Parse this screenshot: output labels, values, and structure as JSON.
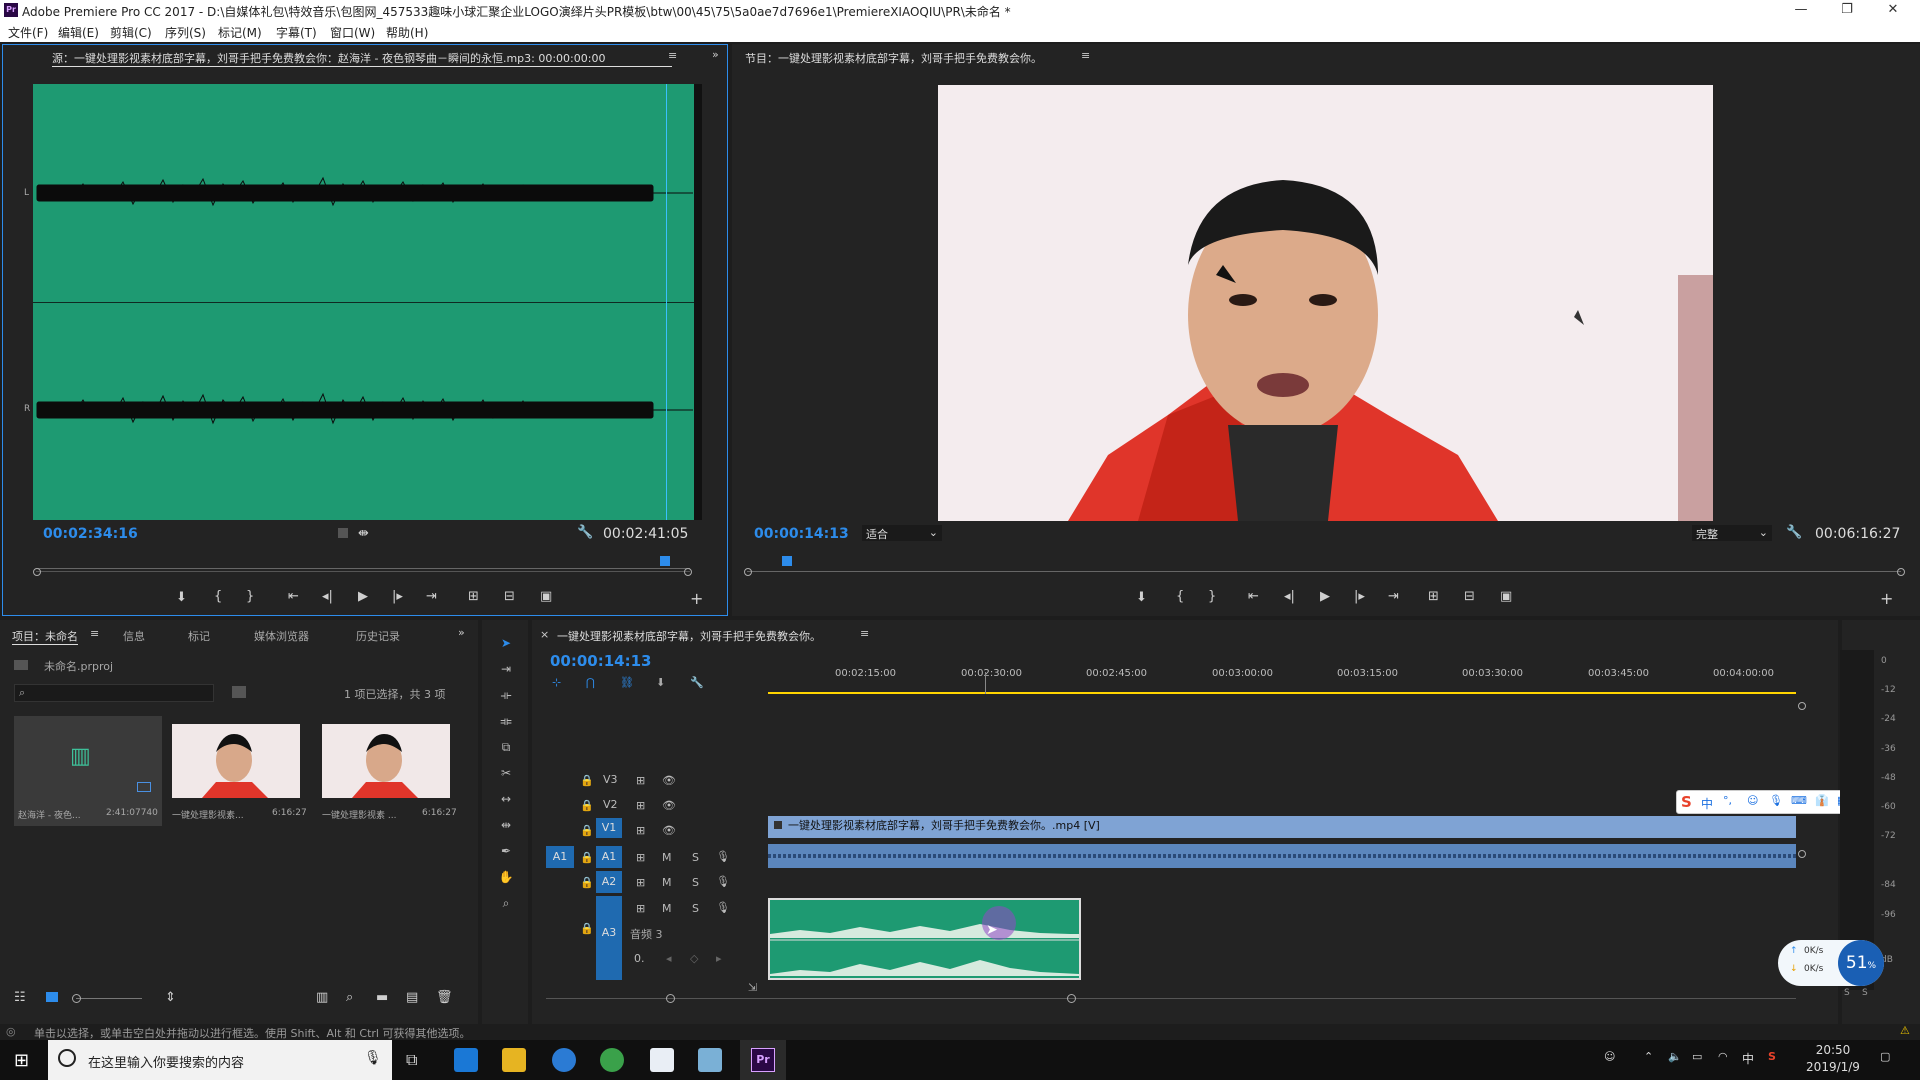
{
  "window": {
    "title": "Adobe Premiere Pro CC 2017 - D:\\自媒体礼包\\特效音乐\\包图网_457533趣味小球汇聚企业LOGO演绎片头PR模板\\btw\\00\\45\\75\\5a0ae7d7696e1\\PremiereXIAOQIU\\PR\\未命名 *",
    "app_icon": "Pr",
    "minimize": "—",
    "maximize": "❐",
    "close": "✕"
  },
  "menu": [
    "文件(F)",
    "编辑(E)",
    "剪辑(C)",
    "序列(S)",
    "标记(M)",
    "字幕(T)",
    "窗口(W)",
    "帮助(H)"
  ],
  "source": {
    "tab_label": "源：一键处理影视素材底部字幕，刘哥手把手免费教会你：赵海洋 - 夜色钢琴曲－瞬间的永恒.mp3: 00:00:00:00",
    "current_tc": "00:02:34:16",
    "duration_tc": "00:02:41:05",
    "channel_left": "L",
    "channel_right": "R"
  },
  "program": {
    "tab_label": "节目：一键处理影视素材底部字幕，刘哥手把手免费教会你。",
    "current_tc": "00:00:14:13",
    "fit": "适合",
    "quality": "完整",
    "duration_tc": "00:06:16:27"
  },
  "project": {
    "tabs": [
      "项目：未命名",
      "信息",
      "标记",
      "媒体浏览器",
      "历史记录"
    ],
    "file": "未命名.prproj",
    "selection_info": "1 项已选择，共 3 项",
    "items": [
      {
        "name": "赵海洋 - 夜色...",
        "duration": "2:41:07740"
      },
      {
        "name": "一键处理影视素...",
        "duration": "6:16:27"
      },
      {
        "name": "一键处理影视素 ...",
        "duration": "6:16:27"
      }
    ]
  },
  "timeline": {
    "tab_label": "一键处理影视素材底部字幕，刘哥手把手免费教会你。",
    "current_tc": "00:00:14:13",
    "ruler": [
      "00:02:15:00",
      "00:02:30:00",
      "00:02:45:00",
      "00:03:00:00",
      "00:03:15:00",
      "00:03:30:00",
      "00:03:45:00",
      "00:04:00:00"
    ],
    "tracks": {
      "v3": "V3",
      "v2": "V2",
      "v1": "V1",
      "a1_src": "A1",
      "a1": "A1",
      "a2": "A2",
      "a3": "A3",
      "a3_name": "音频 3",
      "m": "M",
      "s": "S"
    },
    "v1_clip": "一键处理影视素材底部字幕，刘哥手把手免费教会你。.mp4 [V]",
    "a3_level": "0."
  },
  "vu": {
    "ticks": [
      "0",
      "-12",
      "-24",
      "-36",
      "-48",
      "-60",
      "-72",
      "-84",
      "-96",
      "dB"
    ],
    "solo": [
      "S",
      "S"
    ]
  },
  "net_widget": {
    "up": "0K/s",
    "down": "0K/s",
    "percent": "51",
    "unit": "%"
  },
  "ime_bar": {
    "lang": "中"
  },
  "status_bar": "单击以选择，或单击空白处并拖动以进行框选。使用 Shift、Alt 和 Ctrl 可获得其他选项。",
  "taskbar": {
    "search_placeholder": "在这里输入你要搜索的内容",
    "clock_time": "20:50",
    "clock_date": "2019/1/9",
    "ime": "中"
  },
  "colors": {
    "accent": "#2d8ceb",
    "waveform_bg": "#1e9a72",
    "v1_clip": "#7fa3d4",
    "playhead": "#ffd400"
  }
}
